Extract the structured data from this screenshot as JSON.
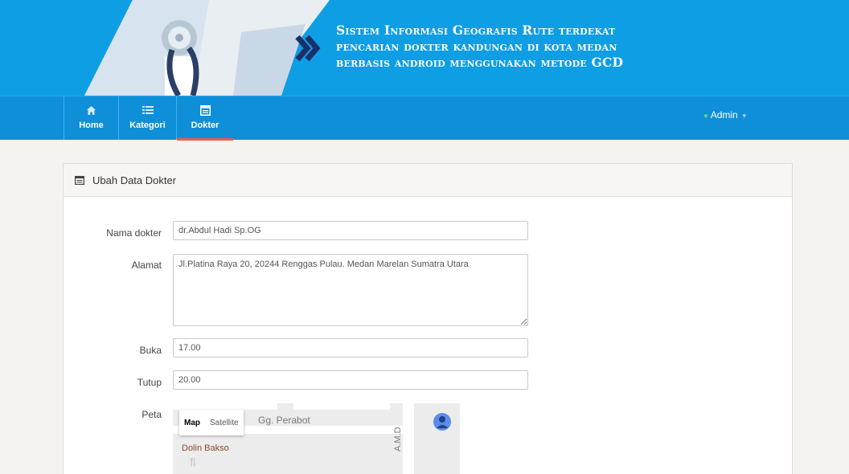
{
  "header": {
    "title_lines": [
      "Sistem Informasi Geografis  Rute terdekat",
      "pencarian dokter kandungan di kota medan",
      "berbasis android menggunakan metode GCD"
    ]
  },
  "nav": {
    "items": [
      {
        "label": "Home",
        "icon": "home-icon"
      },
      {
        "label": "Kategori",
        "icon": "list-icon"
      },
      {
        "label": "Dokter",
        "icon": "window-icon",
        "active": true
      }
    ],
    "user": "Admin",
    "colors": {
      "bar": "#0f8fd8",
      "banner": "#0e9ee4",
      "active": "#f05a5a"
    }
  },
  "card": {
    "title": "Ubah Data Dokter",
    "fields": {
      "nama": {
        "label": "Nama dokter",
        "value": "dr.Abdul Hadi Sp.OG"
      },
      "alamat": {
        "label": "Alamat",
        "value": "Jl.Platina Raya 20, 20244 Renggas Pulau. Medan Marelan Sumatra Utara"
      },
      "buka": {
        "label": "Buka",
        "value": "17.00"
      },
      "tutup": {
        "label": "Tutup",
        "value": "20.00"
      },
      "peta": {
        "label": "Peta"
      }
    }
  },
  "map": {
    "type_map": "Map",
    "type_satellite": "Satellite",
    "street": "Gg. Perabot",
    "poi": "Dolin Bakso",
    "vertical_street": "A.M.D"
  }
}
